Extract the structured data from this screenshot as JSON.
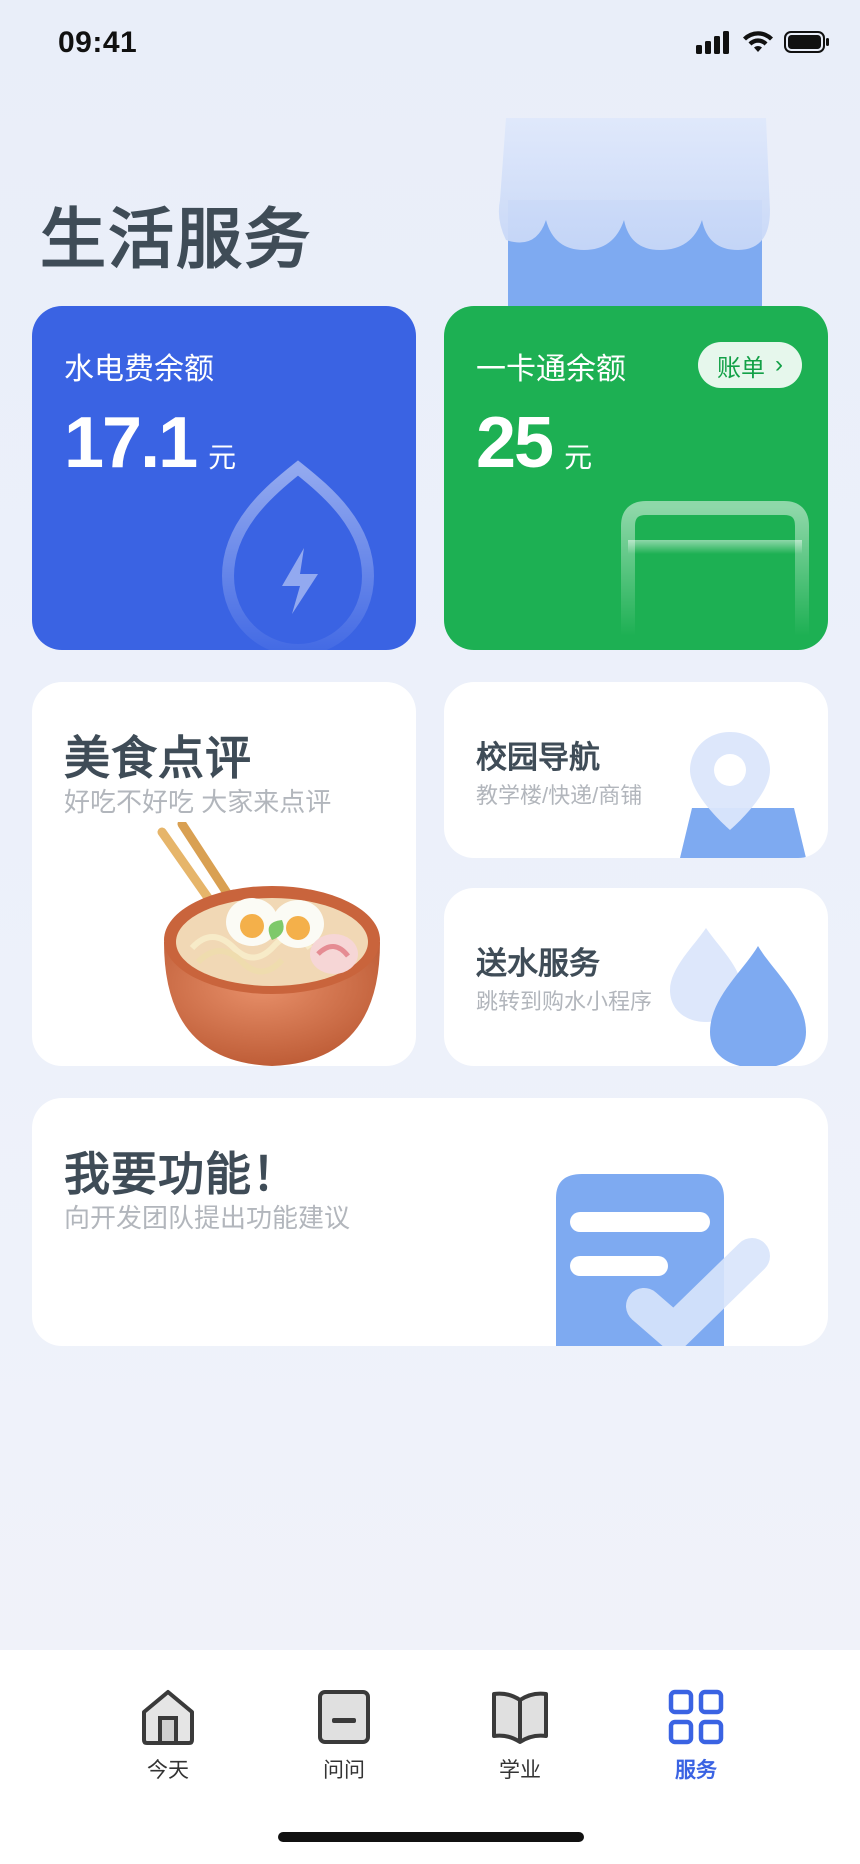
{
  "status_bar": {
    "time": "09:41"
  },
  "page": {
    "title": "生活服务"
  },
  "cards": {
    "utilities": {
      "label": "水电费余额",
      "amount": "17.1",
      "unit": "元",
      "color": "#3a63e3"
    },
    "campus_card": {
      "label": "一卡通余额",
      "amount": "25",
      "unit": "元",
      "bill_button": "账单",
      "color": "#1db053"
    }
  },
  "services": {
    "food_review": {
      "title": "美食点评",
      "subtitle": "好吃不好吃 大家来点评"
    },
    "campus_nav": {
      "title": "校园导航",
      "subtitle": "教学楼/快递/商铺"
    },
    "water_delivery": {
      "title": "送水服务",
      "subtitle": "跳转到购水小程序"
    },
    "feature_request": {
      "title": "我要功能！",
      "subtitle": "向开发团队提出功能建议"
    }
  },
  "tabbar": {
    "items": [
      {
        "label": "今天",
        "icon": "home-icon"
      },
      {
        "label": "问问",
        "icon": "message-icon"
      },
      {
        "label": "学业",
        "icon": "book-icon"
      },
      {
        "label": "服务",
        "icon": "grid-icon",
        "active": true
      }
    ],
    "active_color": "#3a63e3"
  }
}
